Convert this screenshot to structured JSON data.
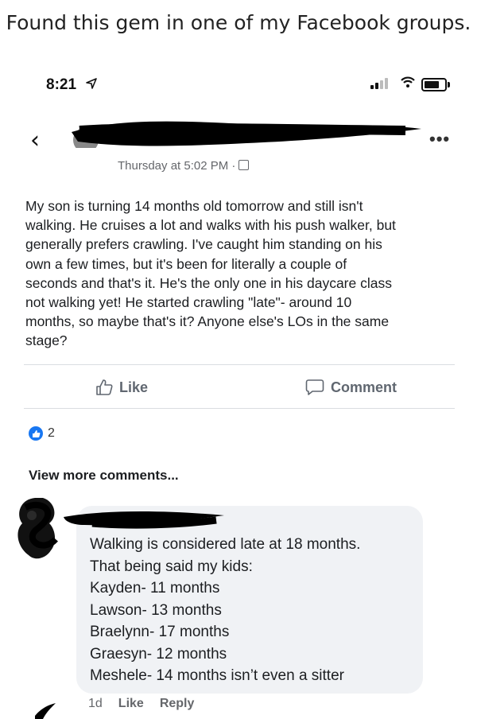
{
  "caption": "Found this gem in one of my Facebook groups.",
  "status_bar": {
    "time": "8:21",
    "location_icon": "location-arrow-icon",
    "icons": [
      "signal-icon",
      "wifi-icon",
      "battery-icon"
    ]
  },
  "header": {
    "back_icon": "‹",
    "more_icon": "•••",
    "timestamp": "Thursday at 5:02 PM ·"
  },
  "post": {
    "lines": [
      "My son is turning 14 months old tomorrow and still isn't",
      "walking. He cruises a lot and walks with his push walker, but",
      "generally prefers crawling. I've caught him standing on his",
      "own a few times, but it's been for literally a couple of",
      "seconds and that's it. He's the only one in his daycare class",
      "not walking yet! He started crawling \"late\"- around 10",
      "months, so maybe that's it? Anyone else's LOs in the same",
      "stage?"
    ],
    "like_label": "Like",
    "comment_label": "Comment",
    "reaction_count": "2"
  },
  "view_more_label": "View more comments...",
  "comment": {
    "lines": [
      "Walking is considered late at 18 months.",
      "That being said my kids:",
      "Kayden- 11 months",
      "Lawson- 13 months",
      "Braelynn- 17 months",
      "Graesyn- 12 months",
      "Meshele- 14 months isn’t even a sitter"
    ],
    "age": "1d",
    "like_label": "Like",
    "reply_label": "Reply"
  },
  "colors": {
    "accent": "#1877f2",
    "bubble": "#f0f2f5",
    "muted": "#65676b"
  }
}
